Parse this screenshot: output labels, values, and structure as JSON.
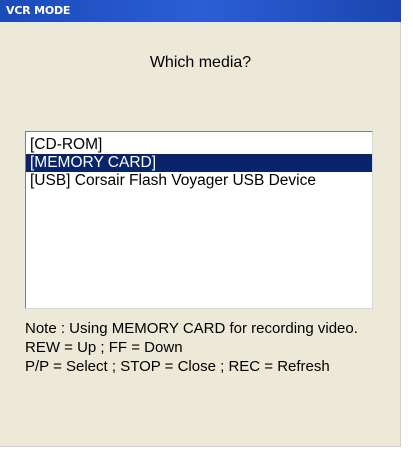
{
  "window": {
    "title": "VCR MODE"
  },
  "prompt": "Which media?",
  "media_list": {
    "items": [
      {
        "label": "[CD-ROM]",
        "selected": false
      },
      {
        "label": "[MEMORY CARD]",
        "selected": true
      },
      {
        "label": "[USB]  Corsair Flash Voyager USB Device",
        "selected": false
      }
    ]
  },
  "help": {
    "note": "Note : Using MEMORY CARD for recording video.",
    "line1": "REW = Up ; FF = Down",
    "line2": "P/P = Select ; STOP = Close ; REC = Refresh"
  },
  "colors": {
    "title_bar": "#2b5ed6",
    "dialog_bg": "#ece9d8",
    "selection": "#0a246a"
  }
}
